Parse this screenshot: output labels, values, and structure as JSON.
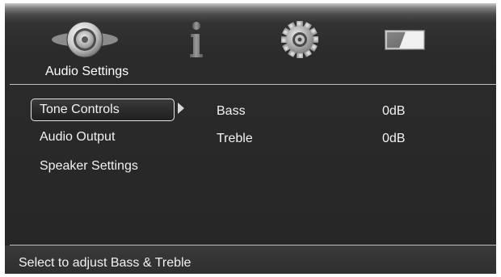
{
  "tabs": [
    {
      "id": "audio",
      "icon": "speaker-icon",
      "selected": true
    },
    {
      "id": "info",
      "icon": "info-icon",
      "selected": false
    },
    {
      "id": "setup",
      "icon": "gear-icon",
      "selected": false
    },
    {
      "id": "display",
      "icon": "display-icon",
      "selected": false
    }
  ],
  "header": {
    "title": "Audio Settings"
  },
  "menu": {
    "items": [
      {
        "label": "Tone Controls",
        "selected": true
      },
      {
        "label": "Audio Output",
        "selected": false
      },
      {
        "label": "Speaker Settings",
        "selected": false
      }
    ]
  },
  "settings": [
    {
      "label": "Bass",
      "value": "0dB"
    },
    {
      "label": "Treble",
      "value": "0dB"
    }
  ],
  "status": {
    "text": "Select to adjust Bass & Treble"
  },
  "colors": {
    "background": "#262626",
    "text": "#f2f2f2",
    "divider": "#bdbdbd"
  }
}
